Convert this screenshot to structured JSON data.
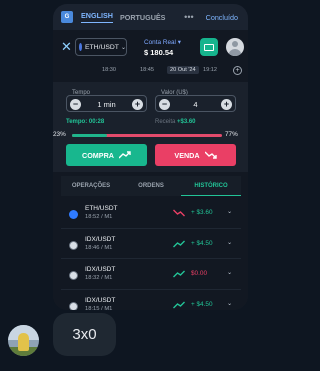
{
  "translate": {
    "icon": "translate-icon",
    "lang_active": "ENGLISH",
    "lang_other": "PORTUGUÊS",
    "done": "Concluído"
  },
  "header": {
    "pair": "ETH/USDT",
    "account_label": "Conta Real",
    "balance": "$ 180.54"
  },
  "timeline": {
    "t1": "18:30",
    "t2": "18:45",
    "date": "20 Out '24",
    "t3": "19:12"
  },
  "trade": {
    "time_label": "Tempo",
    "time_value": "1 min",
    "amount_label": "Valor (U$)",
    "amount_value": "4",
    "countdown": "Tempo: 00:28",
    "payout_label": "Receita",
    "payout_value": "+$3.60",
    "call_pct": "23%",
    "put_pct": "77%",
    "call_share": 0.23,
    "call_label": "COMPRA",
    "put_label": "VENDA"
  },
  "tabs": [
    "OPERAÇÕES",
    "ORDENS",
    "HISTÓRICO"
  ],
  "history": [
    {
      "asset": "ETH/USDT",
      "time": "18:52 / M1",
      "amount": "+ $3.60",
      "direction": "down",
      "amount_color": "#22c497"
    },
    {
      "asset": "IDX/USDT",
      "time": "18:46 / M1",
      "amount": "+ $4.50",
      "direction": "up",
      "amount_color": "#22c497"
    },
    {
      "asset": "IDX/USDT",
      "time": "18:32 / M1",
      "amount": "$0.00",
      "direction": "up",
      "amount_color": "#ea3f65"
    },
    {
      "asset": "IDX/USDT",
      "time": "18:15 / M1",
      "amount": "+ $4.50",
      "direction": "up",
      "amount_color": "#22c497"
    }
  ],
  "message": {
    "text": "3x0"
  },
  "colors": {
    "green": "#18b78e",
    "red": "#ea3f65",
    "accent_blue": "#7fb6ff"
  }
}
